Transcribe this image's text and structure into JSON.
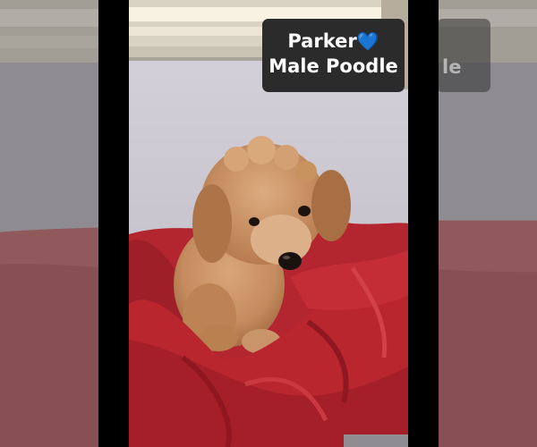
{
  "caption": {
    "name": "Parker",
    "heart": "💙",
    "subtitle": "Male Poodle"
  },
  "ghost": {
    "text": "le"
  },
  "colors": {
    "badge_background": "#2b2b2b",
    "heart": "#5ab4ef",
    "blanket": "#b9262e",
    "puppy_fur": "#c99065",
    "wall": "#c8c5cf"
  }
}
